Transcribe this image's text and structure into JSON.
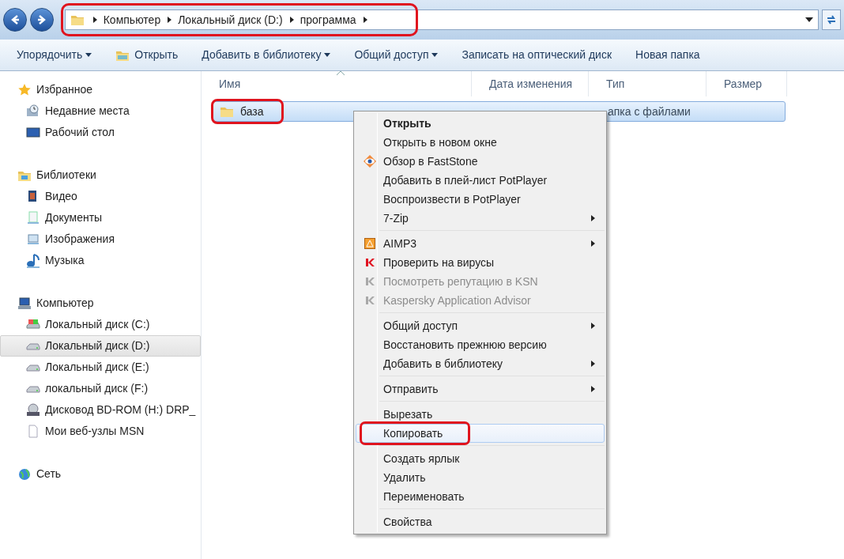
{
  "address": {
    "circled": true,
    "crumbs": [
      "Компьютер",
      "Локальный диск (D:)",
      "программа"
    ]
  },
  "toolbar": [
    {
      "label": "Упорядочить",
      "dropdown": true
    },
    {
      "label": "Открыть",
      "dropdown": false
    },
    {
      "label": "Добавить в библиотеку",
      "dropdown": true
    },
    {
      "label": "Общий доступ",
      "dropdown": true
    },
    {
      "label": "Записать на оптический диск",
      "dropdown": false
    },
    {
      "label": "Новая папка",
      "dropdown": false
    }
  ],
  "sidebar": [
    {
      "label": "Избранное",
      "items": [
        {
          "label": "Недавние места",
          "selected": false
        },
        {
          "label": "Рабочий стол",
          "selected": false
        }
      ]
    },
    {
      "label": "Библиотеки",
      "items": [
        {
          "label": "Видео",
          "selected": false
        },
        {
          "label": "Документы",
          "selected": false
        },
        {
          "label": "Изображения",
          "selected": false
        },
        {
          "label": "Музыка",
          "selected": false
        }
      ]
    },
    {
      "label": "Компьютер",
      "items": [
        {
          "label": "Локальный диск (C:)",
          "selected": false
        },
        {
          "label": "Локальный диск (D:)",
          "selected": true
        },
        {
          "label": "Локальный диск (E:)",
          "selected": false
        },
        {
          "label": "локальный диск (F:)",
          "selected": false
        },
        {
          "label": "Дисковод BD-ROM (H:) DRP_",
          "selected": false
        },
        {
          "label": "Мои веб-узлы MSN",
          "selected": false
        }
      ]
    },
    {
      "label": "Сеть"
    }
  ],
  "table": {
    "columns": [
      "Имя",
      "Дата изменения",
      "Тип",
      "Размер"
    ],
    "rows": [
      {
        "name": "база",
        "type": "апка с файлами",
        "selected": true,
        "circled": true
      }
    ]
  },
  "context_menu": [
    {
      "kind": "item",
      "label": "Открыть",
      "bold": true,
      "disabled": false,
      "submenu": false,
      "selected": false,
      "circled": false
    },
    {
      "kind": "item",
      "label": "Открыть в новом окне",
      "bold": false,
      "disabled": false,
      "submenu": false,
      "selected": false,
      "circled": false
    },
    {
      "kind": "item",
      "label": "Обзор в FastStone",
      "bold": false,
      "disabled": false,
      "submenu": false,
      "selected": false,
      "circled": false
    },
    {
      "kind": "item",
      "label": "Добавить в плей-лист PotPlayer",
      "bold": false,
      "disabled": false,
      "submenu": false,
      "selected": false,
      "circled": false
    },
    {
      "kind": "item",
      "label": "Воспроизвести в PotPlayer",
      "bold": false,
      "disabled": false,
      "submenu": false,
      "selected": false,
      "circled": false
    },
    {
      "kind": "item",
      "label": "7-Zip",
      "bold": false,
      "disabled": false,
      "submenu": true,
      "selected": false,
      "circled": false
    },
    {
      "kind": "separator"
    },
    {
      "kind": "item",
      "label": "AIMP3",
      "bold": false,
      "disabled": false,
      "submenu": true,
      "selected": false,
      "circled": false
    },
    {
      "kind": "item",
      "label": "Проверить на вирусы",
      "bold": false,
      "disabled": false,
      "submenu": false,
      "selected": false,
      "circled": false
    },
    {
      "kind": "item",
      "label": "Посмотреть репутацию в KSN",
      "bold": false,
      "disabled": true,
      "submenu": false,
      "selected": false,
      "circled": false
    },
    {
      "kind": "item",
      "label": "Kaspersky Application Advisor",
      "bold": false,
      "disabled": true,
      "submenu": false,
      "selected": false,
      "circled": false
    },
    {
      "kind": "separator"
    },
    {
      "kind": "item",
      "label": "Общий доступ",
      "bold": false,
      "disabled": false,
      "submenu": true,
      "selected": false,
      "circled": false
    },
    {
      "kind": "item",
      "label": "Восстановить прежнюю версию",
      "bold": false,
      "disabled": false,
      "submenu": false,
      "selected": false,
      "circled": false
    },
    {
      "kind": "item",
      "label": "Добавить в библиотеку",
      "bold": false,
      "disabled": false,
      "submenu": true,
      "selected": false,
      "circled": false
    },
    {
      "kind": "separator"
    },
    {
      "kind": "item",
      "label": "Отправить",
      "bold": false,
      "disabled": false,
      "submenu": true,
      "selected": false,
      "circled": false
    },
    {
      "kind": "separator"
    },
    {
      "kind": "item",
      "label": "Вырезать",
      "bold": false,
      "disabled": false,
      "submenu": false,
      "selected": false,
      "circled": false
    },
    {
      "kind": "item",
      "label": "Копировать",
      "bold": false,
      "disabled": false,
      "submenu": false,
      "selected": true,
      "circled": true
    },
    {
      "kind": "separator"
    },
    {
      "kind": "item",
      "label": "Создать ярлык",
      "bold": false,
      "disabled": false,
      "submenu": false,
      "selected": false,
      "circled": false
    },
    {
      "kind": "item",
      "label": "Удалить",
      "bold": false,
      "disabled": false,
      "submenu": false,
      "selected": false,
      "circled": false
    },
    {
      "kind": "item",
      "label": "Переименовать",
      "bold": false,
      "disabled": false,
      "submenu": false,
      "selected": false,
      "circled": false
    },
    {
      "kind": "separator"
    },
    {
      "kind": "item",
      "label": "Свойства",
      "bold": false,
      "disabled": false,
      "submenu": false,
      "selected": false,
      "circled": false
    }
  ]
}
